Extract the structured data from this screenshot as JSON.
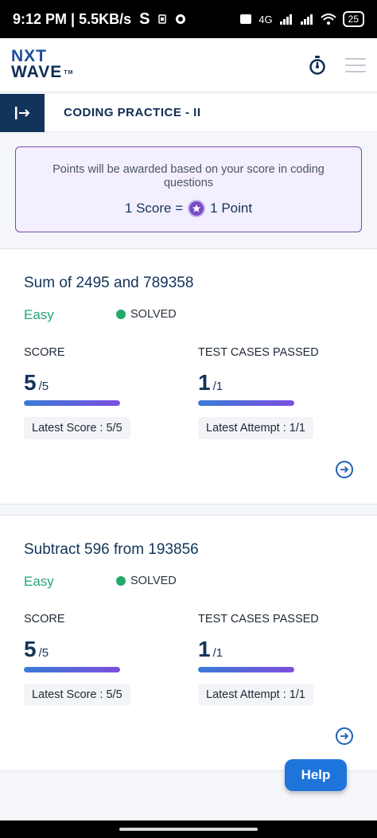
{
  "status_bar": {
    "time_speed": "9:12 PM | 5.5KB/s",
    "s_glyph": "S",
    "network": "4G",
    "battery": "25"
  },
  "header": {
    "logo_line1": "NXT",
    "logo_line2": "WAVE",
    "logo_tm": "TM"
  },
  "titlebar": {
    "title": "CODING PRACTICE - II"
  },
  "info": {
    "text": "Points will be awarded based on your score in coding questions",
    "score_left": "1 Score =",
    "score_right": "1 Point"
  },
  "problems": [
    {
      "title": "Sum of 2495 and 789358",
      "difficulty": "Easy",
      "status": "SOLVED",
      "score_label": "SCORE",
      "score_value": "5",
      "score_total": "/5",
      "score_fraction": 1.0,
      "latest_score": "Latest Score : 5/5",
      "tests_label": "TEST CASES PASSED",
      "tests_value": "1",
      "tests_total": "/1",
      "tests_fraction": 1.0,
      "latest_attempt": "Latest Attempt : 1/1"
    },
    {
      "title": "Subtract 596 from 193856",
      "difficulty": "Easy",
      "status": "SOLVED",
      "score_label": "SCORE",
      "score_value": "5",
      "score_total": "/5",
      "score_fraction": 1.0,
      "latest_score": "Latest Score : 5/5",
      "tests_label": "TEST CASES PASSED",
      "tests_value": "1",
      "tests_total": "/1",
      "tests_fraction": 1.0,
      "latest_attempt": "Latest Attempt : 1/1"
    }
  ],
  "help": {
    "label": "Help"
  },
  "icons": {
    "timer": "stopwatch-icon",
    "menu": "hamburger-menu-icon",
    "collapse": "sidebar-expand-icon",
    "star": "star-coin-icon",
    "arrow": "arrow-right-circle-icon"
  },
  "colors": {
    "brand_navy": "#13345a",
    "easy_green": "#25a47b",
    "solved_dot": "#21a96b",
    "info_border": "#7a4ca8",
    "info_bg": "#f3efff",
    "help_blue": "#1e74db"
  }
}
